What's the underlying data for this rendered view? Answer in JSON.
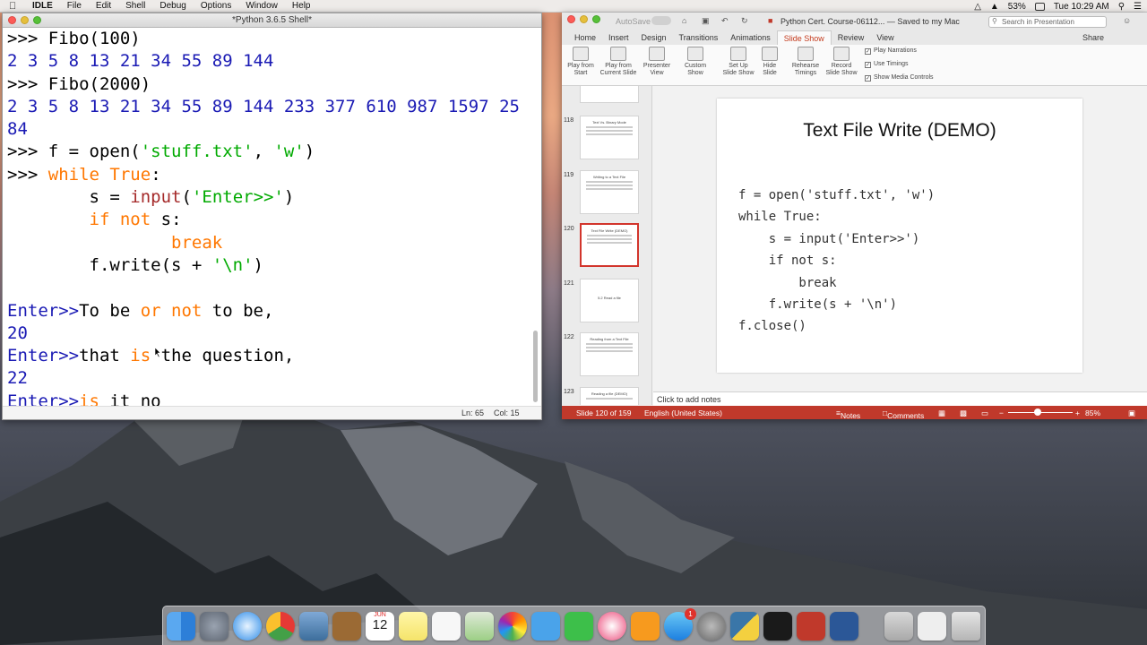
{
  "menubar": {
    "app_name": "IDLE",
    "menus": [
      "File",
      "Edit",
      "Shell",
      "Debug",
      "Options",
      "Window",
      "Help"
    ],
    "battery": "53%",
    "clock": "Tue 10:29 AM"
  },
  "idle_window": {
    "title": "*Python 3.6.5 Shell*",
    "status_line": "Ln: 65",
    "status_col": "Col: 15",
    "shell_lines": [
      [
        {
          "t": ">>> ",
          "c": "c-in"
        },
        {
          "t": "Fibo(100)",
          "c": "c-in"
        }
      ],
      [
        {
          "t": "2 3 5 8 13 21 34 55 89 144",
          "c": "c-out"
        }
      ],
      [
        {
          "t": ">>> ",
          "c": "c-in"
        },
        {
          "t": "Fibo(2000)",
          "c": "c-in"
        }
      ],
      [
        {
          "t": "2 3 5 8 13 21 34 55 89 144 233 377 610 987 1597 25",
          "c": "c-out"
        }
      ],
      [
        {
          "t": "84",
          "c": "c-out"
        }
      ],
      [
        {
          "t": ">>> ",
          "c": "c-in"
        },
        {
          "t": "f = open(",
          "c": "c-in"
        },
        {
          "t": "'stuff.txt'",
          "c": "c-str"
        },
        {
          "t": ", ",
          "c": "c-in"
        },
        {
          "t": "'w'",
          "c": "c-str"
        },
        {
          "t": ")",
          "c": "c-in"
        }
      ],
      [
        {
          "t": ">>> ",
          "c": "c-in"
        },
        {
          "t": "while",
          "c": "c-kw"
        },
        {
          "t": " ",
          "c": "c-in"
        },
        {
          "t": "True",
          "c": "c-kw"
        },
        {
          "t": ":",
          "c": "c-in"
        }
      ],
      [
        {
          "t": "        s = ",
          "c": "c-in"
        },
        {
          "t": "input",
          "c": "c-prompt"
        },
        {
          "t": "(",
          "c": "c-in"
        },
        {
          "t": "'Enter>>'",
          "c": "c-str"
        },
        {
          "t": ")",
          "c": "c-in"
        }
      ],
      [
        {
          "t": "        ",
          "c": "c-in"
        },
        {
          "t": "if",
          "c": "c-kw"
        },
        {
          "t": " ",
          "c": "c-in"
        },
        {
          "t": "not",
          "c": "c-kw"
        },
        {
          "t": " s:",
          "c": "c-in"
        }
      ],
      [
        {
          "t": "                ",
          "c": "c-in"
        },
        {
          "t": "break",
          "c": "c-kw"
        }
      ],
      [
        {
          "t": "        f.write(s + ",
          "c": "c-in"
        },
        {
          "t": "'\\n'",
          "c": "c-str"
        },
        {
          "t": ")",
          "c": "c-in"
        }
      ],
      [
        {
          "t": "",
          "c": "c-in"
        }
      ],
      [
        {
          "t": "Enter>>",
          "c": "c-out"
        },
        {
          "t": "To be ",
          "c": "c-in"
        },
        {
          "t": "or not",
          "c": "c-kw"
        },
        {
          "t": " to be,",
          "c": "c-in"
        }
      ],
      [
        {
          "t": "20",
          "c": "c-out"
        }
      ],
      [
        {
          "t": "Enter>>",
          "c": "c-out"
        },
        {
          "t": "that ",
          "c": "c-in"
        },
        {
          "t": "is",
          "c": "c-kw"
        },
        {
          "t": " the question,",
          "c": "c-in"
        }
      ],
      [
        {
          "t": "22",
          "c": "c-out"
        }
      ],
      [
        {
          "t": "Enter>>",
          "c": "c-out"
        },
        {
          "t": "is",
          "c": "c-kw"
        },
        {
          "t": " it no",
          "c": "c-in"
        }
      ]
    ]
  },
  "ppt_window": {
    "autosave": "AutoSave",
    "title": "Python Cert. Course-06112... — Saved to my Mac",
    "search_placeholder": "Search in Presentation",
    "tabs": [
      "Home",
      "Insert",
      "Design",
      "Transitions",
      "Animations",
      "Slide Show",
      "Review",
      "View"
    ],
    "active_tab": "Slide Show",
    "share": "Share",
    "ribbon_buttons": [
      {
        "l1": "Play from",
        "l2": "Start"
      },
      {
        "l1": "Play from",
        "l2": "Current Slide"
      },
      {
        "l1": "Presenter",
        "l2": "View"
      },
      {
        "l1": "Custom",
        "l2": "Show"
      },
      {
        "l1": "Set Up",
        "l2": "Slide Show"
      },
      {
        "l1": "Hide",
        "l2": "Slide"
      },
      {
        "l1": "Rehearse",
        "l2": "Timings"
      },
      {
        "l1": "Record",
        "l2": "Slide Show"
      }
    ],
    "checkboxes": [
      "Play Narrations",
      "Use Timings",
      "Show Media Controls"
    ],
    "thumbnails": [
      {
        "num": "118",
        "title": "Text Vs. Binary Mode"
      },
      {
        "num": "119",
        "title": "Writing to a Text File"
      },
      {
        "num": "120",
        "title": "Text File Write (DEMO)"
      },
      {
        "num": "121",
        "title": "5.2 Read a file"
      },
      {
        "num": "122",
        "title": "Reading from a Text File"
      },
      {
        "num": "123",
        "title": "Reading a file (DEMO)"
      }
    ],
    "selected_slide": "120",
    "slide": {
      "title": "Text File Write (DEMO)",
      "code": "f = open('stuff.txt', 'w')\nwhile True:\n    s = input('Enter>>')\n    if not s:\n        break\n    f.write(s + '\\n')\nf.close()"
    },
    "notes_placeholder": "Click to add notes",
    "status": {
      "slide_of": "Slide 120 of 159",
      "language": "English (United States)",
      "notes": "Notes",
      "comments": "Comments",
      "zoom": "85%"
    }
  },
  "dock": {
    "calendar_month": "JUN",
    "calendar_day": "12",
    "appstore_badge": "1"
  }
}
